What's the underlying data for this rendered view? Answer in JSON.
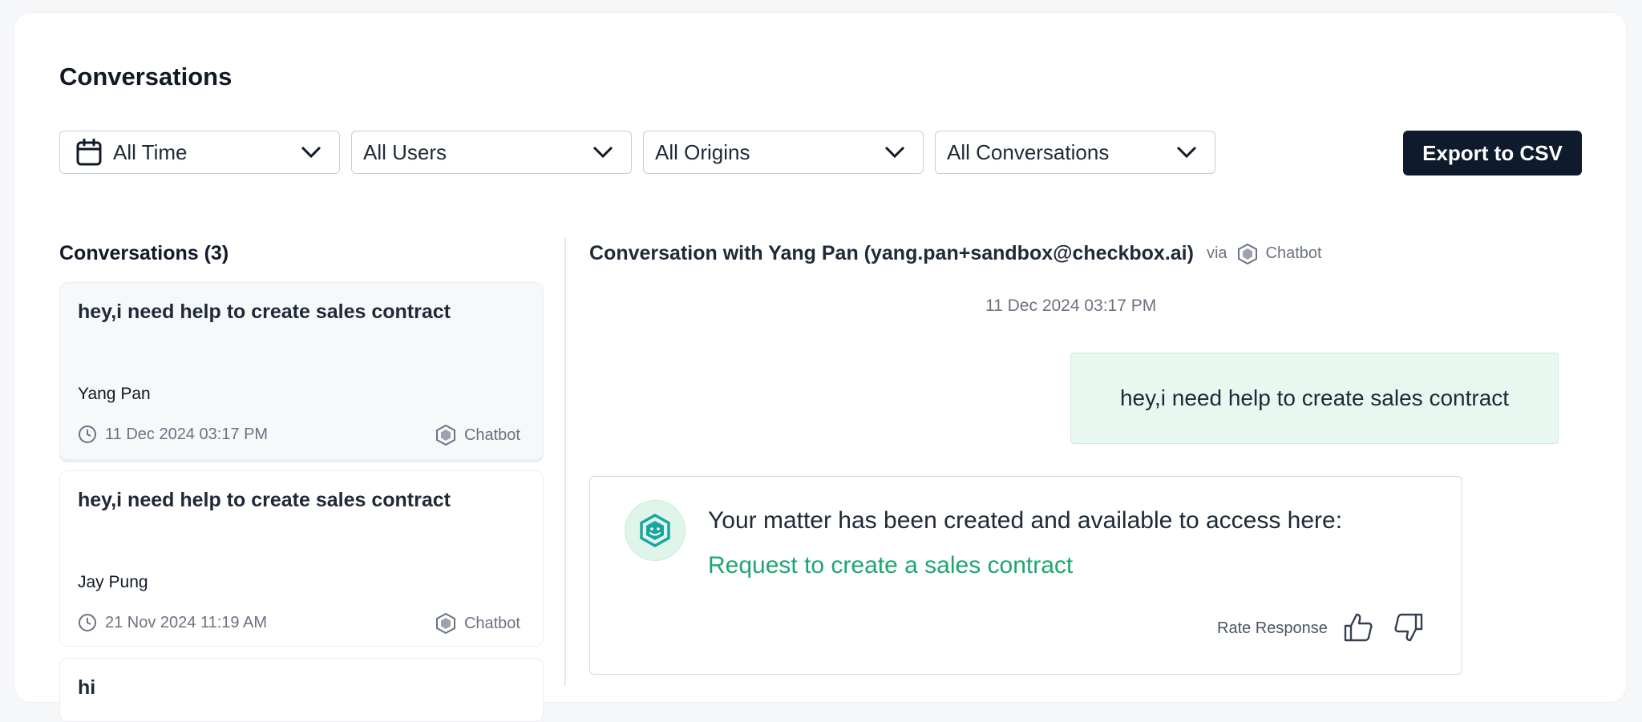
{
  "page": {
    "title": "Conversations"
  },
  "filters": {
    "time": "All Time",
    "users": "All Users",
    "origins": "All Origins",
    "conversations": "All Conversations"
  },
  "toolbar": {
    "export_label": "Export to CSV"
  },
  "list": {
    "heading": "Conversations (3)",
    "items": [
      {
        "title": "hey,i need help to create sales contract",
        "user": "Yang Pan",
        "timestamp": "11 Dec 2024 03:17 PM",
        "origin": "Chatbot"
      },
      {
        "title": "hey,i need help to create sales contract",
        "user": "Jay Pung",
        "timestamp": "21 Nov 2024 11:19 AM",
        "origin": "Chatbot"
      },
      {
        "title": "hi"
      }
    ]
  },
  "thread": {
    "title": "Conversation with Yang Pan (yang.pan+sandbox@checkbox.ai)",
    "via_label": "via",
    "origin": "Chatbot",
    "timestamp": "11 Dec 2024 03:17 PM",
    "user_message": "hey,i need help to create sales contract",
    "bot_message": "Your matter has been created and available to access here:",
    "bot_link": "Request to create a sales contract",
    "rate_label": "Rate Response"
  },
  "colors": {
    "accent": "#1ea672",
    "primary_button": "#0f1b2d",
    "user_bubble": "#e8f7f0"
  },
  "icons": [
    "calendar-icon",
    "chevron-down-icon",
    "clock-icon",
    "chatbot-icon",
    "thumbs-up-icon",
    "thumbs-down-icon"
  ]
}
